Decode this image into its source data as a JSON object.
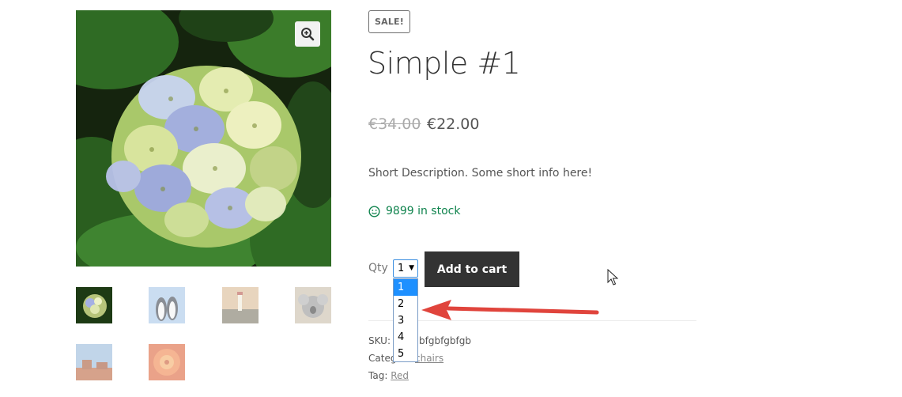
{
  "badge": {
    "sale": "SALE!"
  },
  "product": {
    "title": "Simple #1",
    "price_old": "€34.00",
    "price_new": "€22.00",
    "short_description": "Short Description. Some short info here!",
    "stock": "9899 in stock"
  },
  "cart": {
    "qty_label": "Qty",
    "qty_value": "1",
    "qty_options": [
      "1",
      "2",
      "3",
      "4",
      "5"
    ],
    "add_label": "Add to cart"
  },
  "meta": {
    "sku_label": "SKU:",
    "sku_value": "bfgbfgbfgb",
    "category_label": "Categ",
    "category_value": "chairs",
    "tag_label": "Tag:",
    "tag_value": "Red"
  },
  "icons": {
    "zoom": "magnifier-plus-icon",
    "stock": "smiley-icon",
    "caret": "caret-down-icon"
  },
  "colors": {
    "in_stock": "#0f834d",
    "button_bg": "#333333",
    "selected_option": "#1e90ff",
    "annotation_arrow": "#e0443c"
  }
}
